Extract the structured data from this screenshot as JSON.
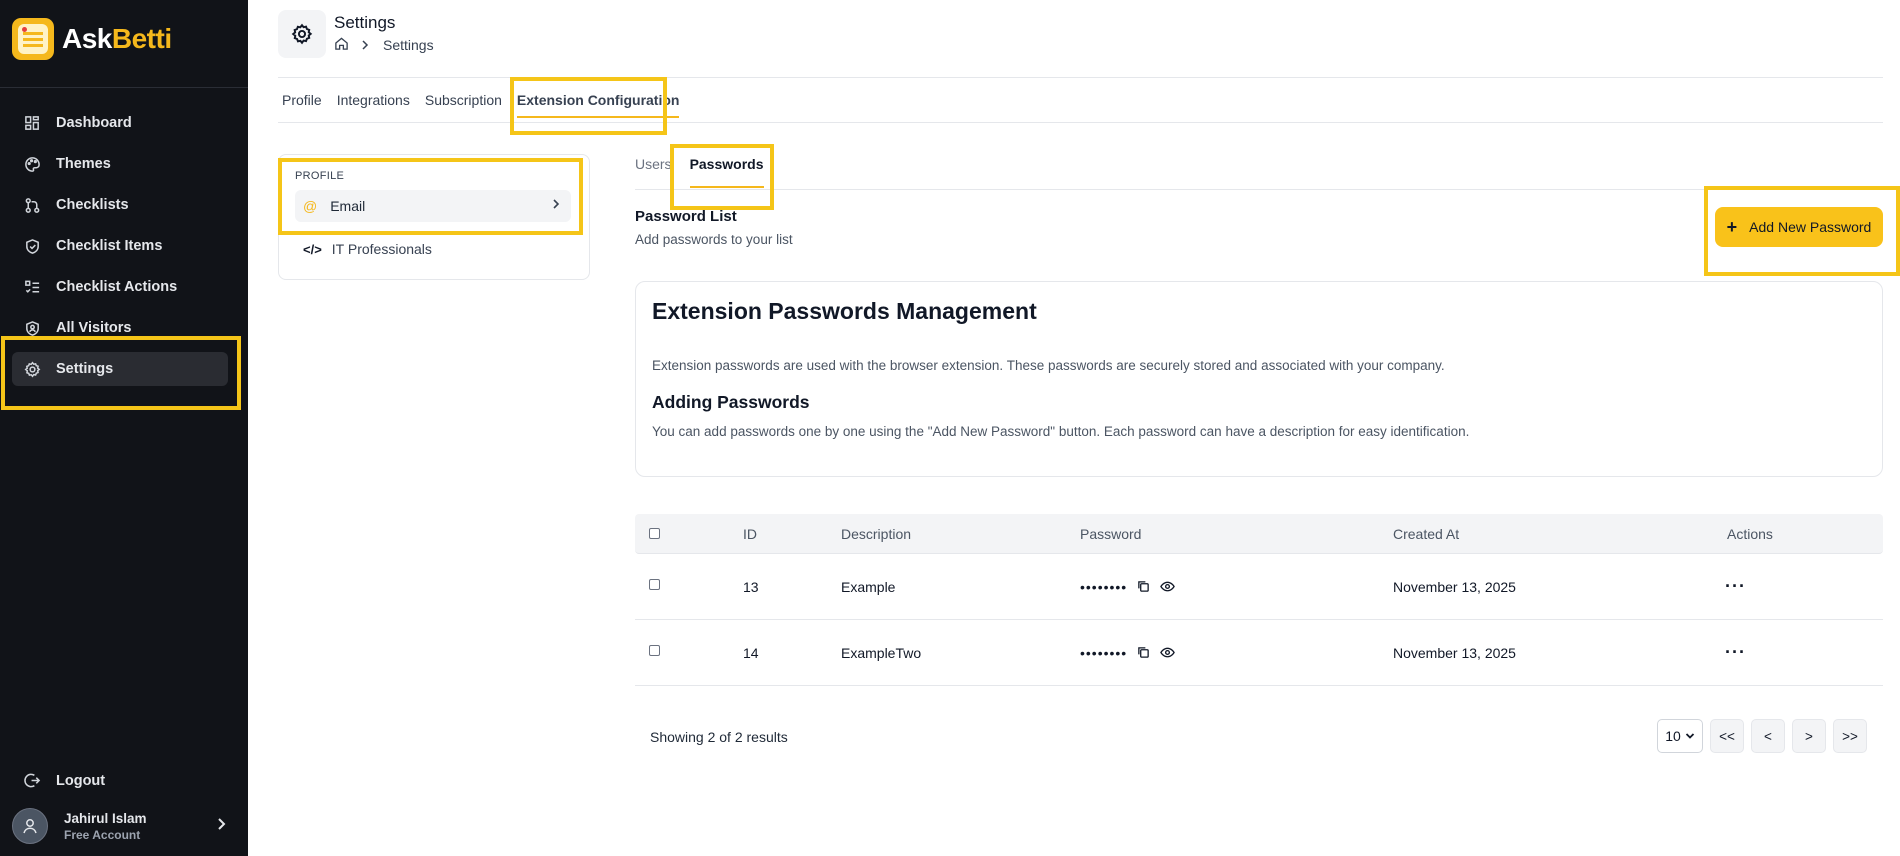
{
  "brand": {
    "name_part1": "Ask",
    "name_part2": "Betti"
  },
  "sidebar": {
    "items": [
      {
        "label": "Dashboard",
        "icon": "dashboard-icon"
      },
      {
        "label": "Themes",
        "icon": "palette-icon"
      },
      {
        "label": "Checklists",
        "icon": "git-branch-icon"
      },
      {
        "label": "Checklist Items",
        "icon": "shield-check-icon"
      },
      {
        "label": "Checklist Actions",
        "icon": "list-check-icon"
      },
      {
        "label": "All Visitors",
        "icon": "shield-user-icon"
      },
      {
        "label": "Settings",
        "icon": "gear-icon",
        "active": true
      }
    ],
    "logout_label": "Logout",
    "user": {
      "name": "Jahirul Islam",
      "plan": "Free Account"
    }
  },
  "header": {
    "title": "Settings",
    "breadcrumb": {
      "current": "Settings"
    }
  },
  "tabs": [
    {
      "label": "Profile"
    },
    {
      "label": "Integrations"
    },
    {
      "label": "Subscription"
    },
    {
      "label": "Extension Configuration",
      "active": true
    }
  ],
  "profile_panel": {
    "section_label": "PROFILE",
    "items": [
      {
        "label": "Email",
        "icon": "at-icon"
      },
      {
        "label": "IT Professionals",
        "icon": "code-icon"
      }
    ]
  },
  "subtabs": [
    {
      "label": "Users"
    },
    {
      "label": "Passwords",
      "active": true
    }
  ],
  "password_list": {
    "title": "Password List",
    "subtitle": "Add passwords to your list",
    "add_button_label": "Add New Password"
  },
  "info_card": {
    "heading": "Extension Passwords Management",
    "paragraph1": "Extension passwords are used with the browser extension. These passwords are securely stored and associated with your company.",
    "subheading": "Adding Passwords",
    "paragraph2": "You can add passwords one by one using the \"Add New Password\" button. Each password can have a description for easy identification."
  },
  "table": {
    "columns": [
      "ID",
      "Description",
      "Password",
      "Created At",
      "Actions"
    ],
    "rows": [
      {
        "id": "13",
        "description": "Example",
        "password": "••••••••",
        "created_at": "November 13, 2025",
        "actions": "···"
      },
      {
        "id": "14",
        "description": "ExampleTwo",
        "password": "••••••••",
        "created_at": "November 13, 2025",
        "actions": "···"
      }
    ]
  },
  "pagination": {
    "summary": "Showing 2 of 2 results",
    "page_size": "10",
    "first": "<<",
    "prev": "<",
    "next": ">",
    "last": ">>"
  },
  "colors": {
    "accent": "#f5b81c",
    "sidebar_bg": "#111318",
    "highlight": "#f5c518"
  }
}
